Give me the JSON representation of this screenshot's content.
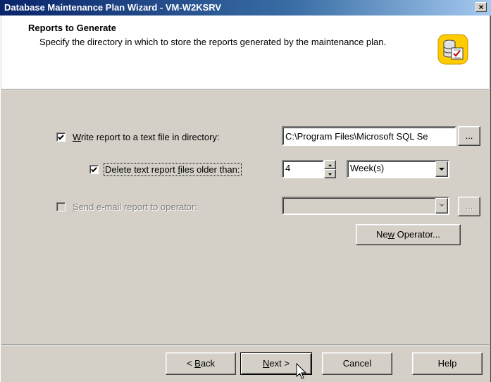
{
  "window": {
    "title": "Database Maintenance Plan Wizard - VM-W2KSRV",
    "close_label": "×"
  },
  "header": {
    "title": "Reports to Generate",
    "description": "Specify the directory in which to store the reports generated by the maintenance plan.",
    "icon": "database-wizard-icon"
  },
  "options": {
    "write_report": {
      "checked": true,
      "label_underlined": "W",
      "label_rest": "rite report to a text file in directory:"
    },
    "report_directory": {
      "value": "C:\\Program Files\\Microsoft SQL Se",
      "browse_label": "..."
    },
    "delete_reports": {
      "checked": true,
      "label_pre": "Delete text report ",
      "label_underlined": "f",
      "label_post": "iles older than:"
    },
    "age_value": "4",
    "age_unit": "Week(s)",
    "send_email": {
      "checked": false,
      "label_underlined": "S",
      "label_rest": "end e-mail report to operator:"
    },
    "operator_value": "",
    "operator_browse_label": "...",
    "new_operator": {
      "label_pre": "Ne",
      "label_underlined": "w",
      "label_post": " Operator..."
    }
  },
  "footer": {
    "back": {
      "label_pre": "< ",
      "label_underlined": "B",
      "label_post": "ack"
    },
    "next": {
      "label_underlined": "N",
      "label_post": "ext >"
    },
    "cancel": "Cancel",
    "help": "Help"
  },
  "colors": {
    "title_start": "#0a246a",
    "title_end": "#a6caf0",
    "face": "#d4d0c8"
  }
}
